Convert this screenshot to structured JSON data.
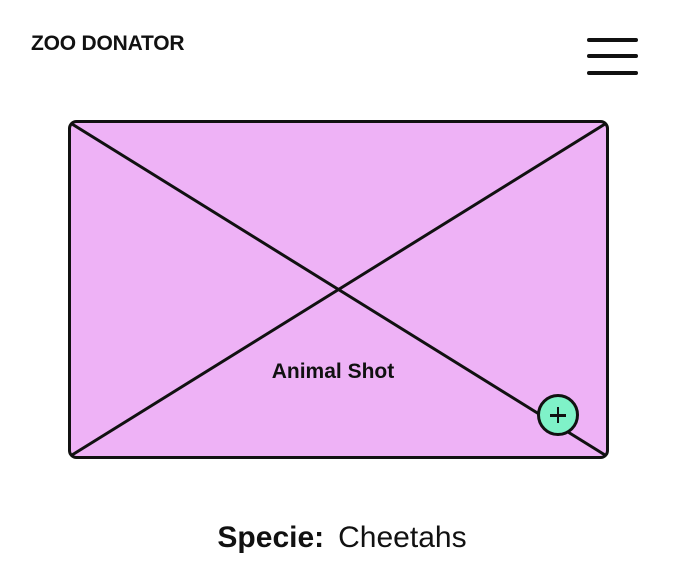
{
  "header": {
    "title": "ZOO DONATOR",
    "menu_icon": "hamburger-menu-icon"
  },
  "image": {
    "placeholder_label": "Animal Shot",
    "fill_color": "#EEB2F6",
    "add_button_icon": "plus-icon",
    "add_button_color": "#7FF2C8"
  },
  "details": {
    "species_label": "Specie:",
    "species_value": "Cheetahs"
  }
}
